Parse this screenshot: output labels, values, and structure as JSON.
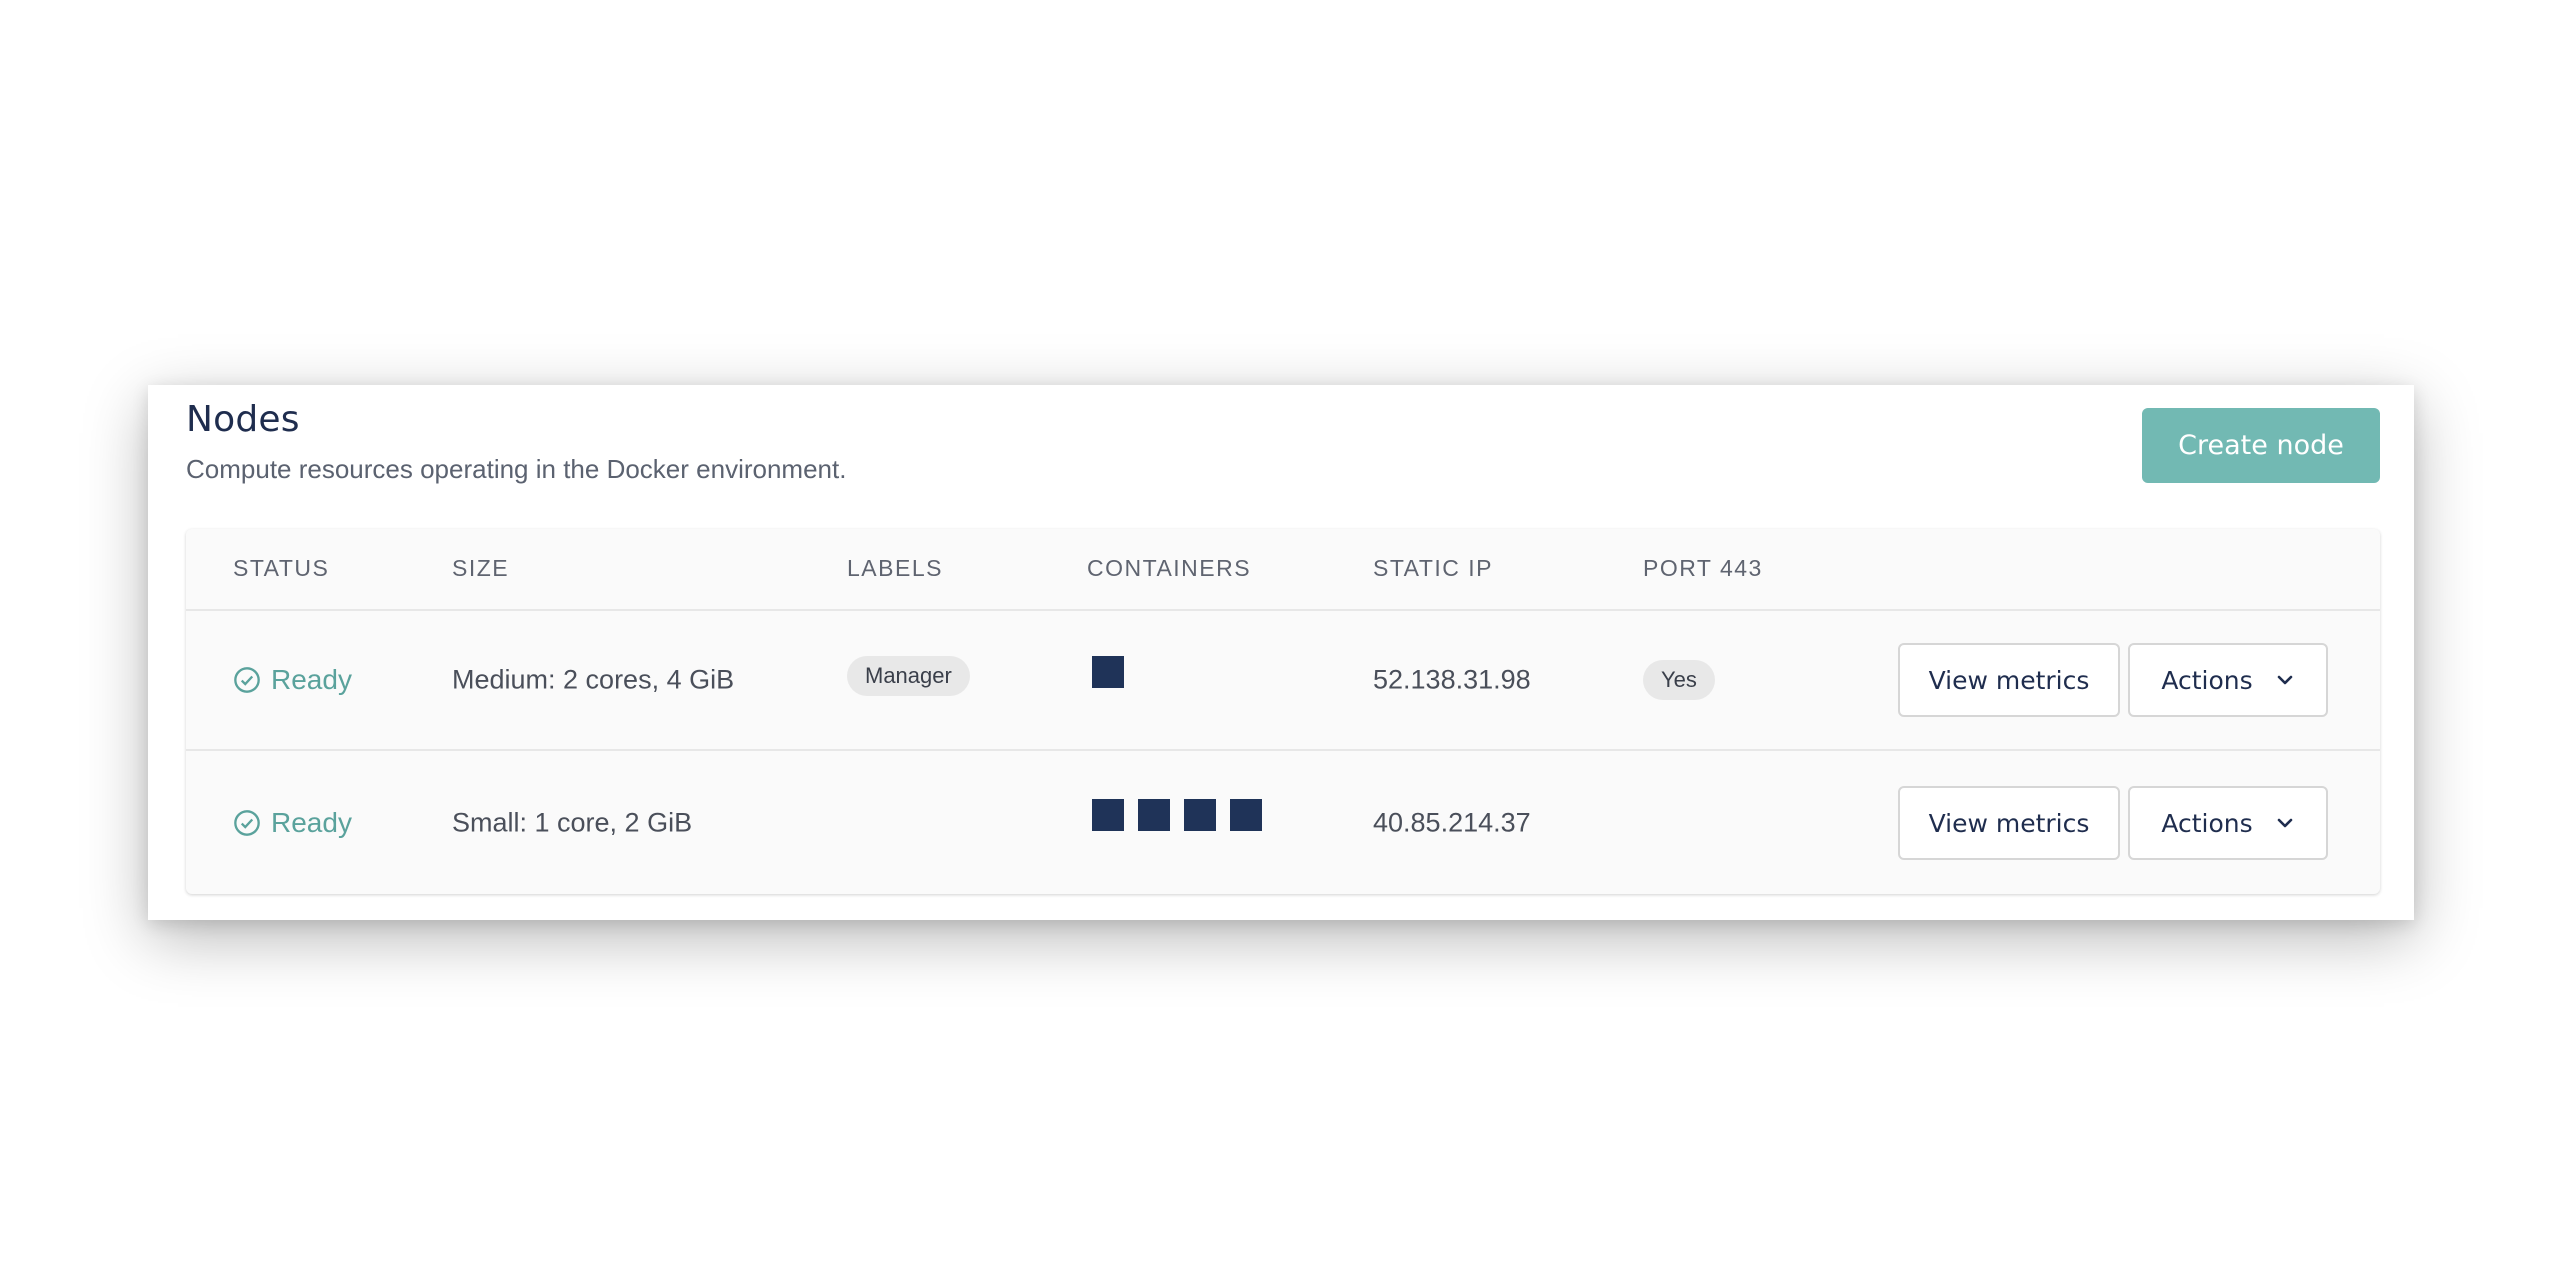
{
  "header": {
    "title": "Nodes",
    "subtitle": "Compute resources operating in the Docker environment.",
    "create_button": "Create node"
  },
  "columns": {
    "status": "STATUS",
    "size": "SIZE",
    "labels": "LABELS",
    "containers": "CONTAINERS",
    "static_ip": "STATIC IP",
    "port": "PORT 443"
  },
  "rows": [
    {
      "status": "Ready",
      "size": "Medium: 2 cores, 4 GiB",
      "label": "Manager",
      "containers": 1,
      "static_ip": "52.138.31.98",
      "port": "Yes",
      "metrics_button": "View metrics",
      "actions_button": "Actions"
    },
    {
      "status": "Ready",
      "size": "Small: 1 core, 2 GiB",
      "label": "",
      "containers": 4,
      "static_ip": "40.85.214.37",
      "port": "",
      "metrics_button": "View metrics",
      "actions_button": "Actions"
    }
  ],
  "icons": {
    "status": "check-circle-icon",
    "actions": "chevron-down-icon"
  },
  "colors": {
    "accent": "#72b9b3",
    "status_ready": "#5aa29c",
    "title": "#1f2d4e",
    "container_box": "#1f3358"
  }
}
